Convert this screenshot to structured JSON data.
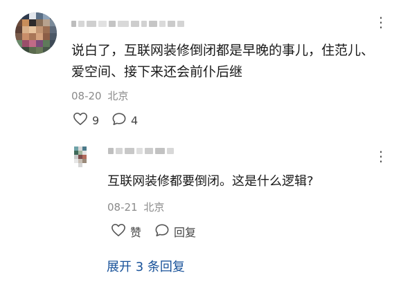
{
  "comment": {
    "text": "说白了，互联网装修倒闭都是早晚的事儿，住范儿、爱空间、接下来还会前仆后继",
    "date": "08-20",
    "location": "北京",
    "like_count": "9",
    "reply_count": "4",
    "icons": {
      "like": "heart-icon",
      "reply": "comment-bubble-icon",
      "more": "more-dots-icon"
    }
  },
  "reply": {
    "text": "互联网装修都要倒闭。这是什么逻辑?",
    "date": "08-21",
    "location": "北京",
    "like_label": "赞",
    "reply_label": "回复"
  },
  "expand_label": "展开 3 条回复"
}
